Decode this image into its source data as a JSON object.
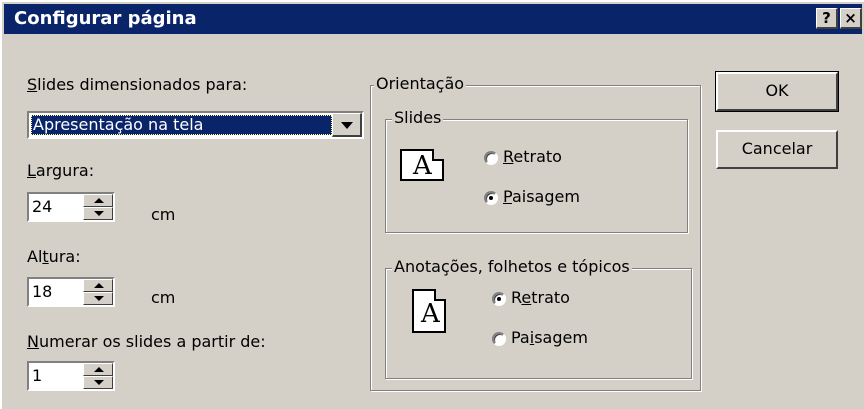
{
  "window": {
    "title": "Configurar página",
    "help_label": "?",
    "close_label": "×"
  },
  "size": {
    "label_mnemonic": "S",
    "label_rest": "lides dimensionados para:",
    "selected_value": "Apresentação na tela"
  },
  "width": {
    "label_mnemonic": "L",
    "label_rest": "argura:",
    "value": "24",
    "unit": "cm"
  },
  "height": {
    "label_pre": "Al",
    "label_mnemonic": "t",
    "label_rest": "ura:",
    "value": "18",
    "unit": "cm"
  },
  "numbering": {
    "label_mnemonic": "N",
    "label_rest": "umerar os slides a partir de:",
    "value": "1"
  },
  "orientation": {
    "title": "Orientação",
    "slides": {
      "title": "Slides",
      "portrait_mnemonic": "R",
      "portrait_rest": "etrato",
      "landscape_mnemonic": "P",
      "landscape_rest": "aisagem",
      "selected": "landscape"
    },
    "notes": {
      "title": "Anotações, folhetos e  tópicos",
      "portrait_pre": "R",
      "portrait_mnemonic": "e",
      "portrait_rest": "trato",
      "landscape_pre": "Pa",
      "landscape_mnemonic": "i",
      "landscape_rest": "sagem",
      "selected": "portrait"
    }
  },
  "buttons": {
    "ok": "OK",
    "cancel": "Cancelar"
  },
  "icon_glyph": "A",
  "colors": {
    "title_bar": "#0a246a",
    "dialog_face": "#d4d0c8",
    "selection": "#0a246a"
  }
}
